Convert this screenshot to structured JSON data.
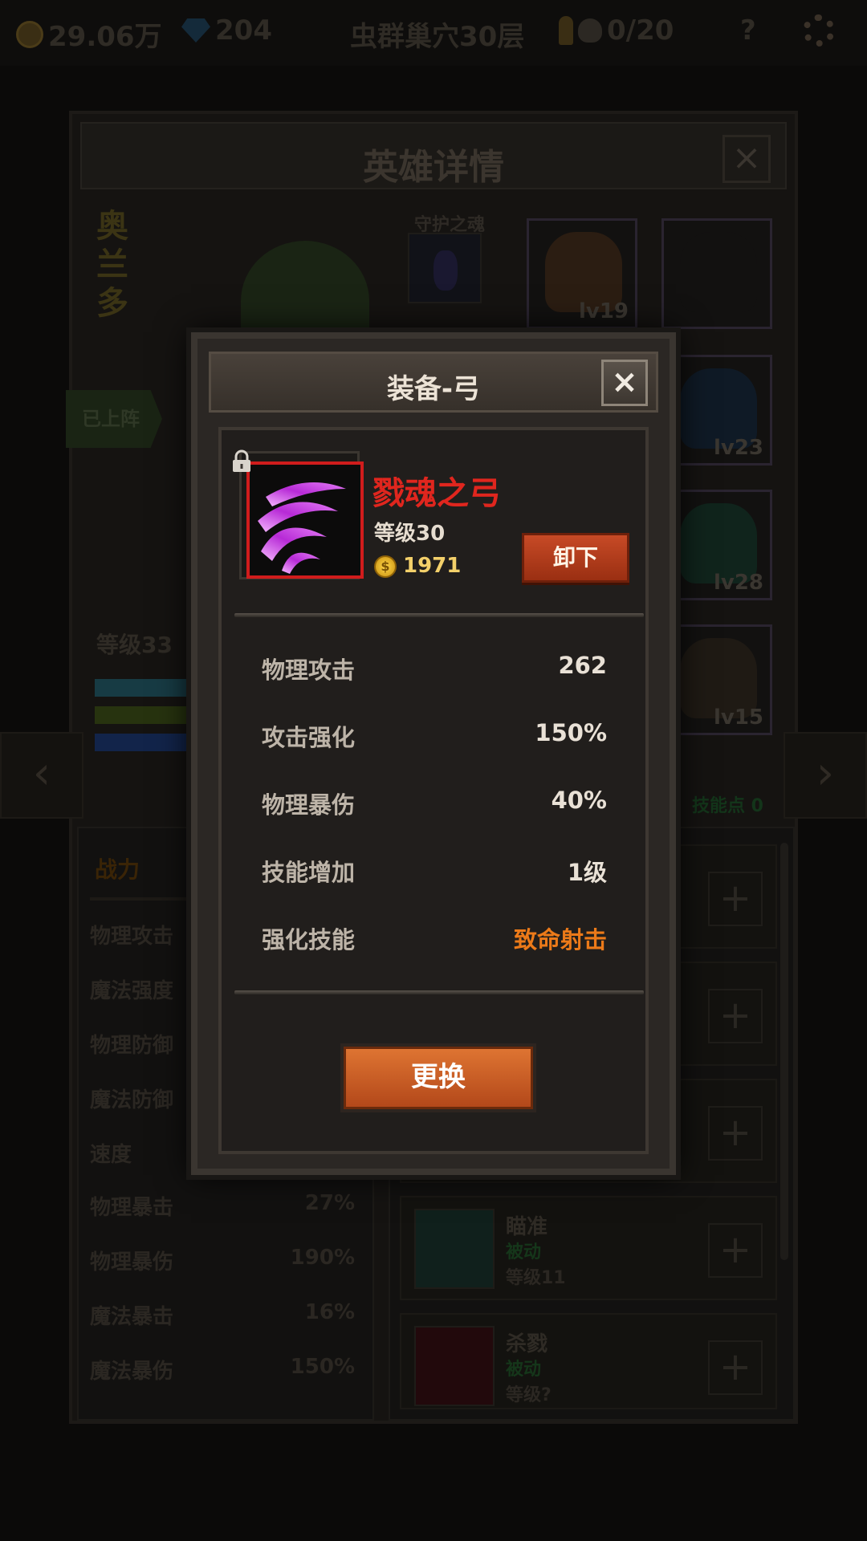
{
  "topbar": {
    "gold": "29.06万",
    "gems": "204",
    "location": "虫群巢穴30层",
    "keys": "0/20",
    "help": "?"
  },
  "hero": {
    "panel_title": "英雄详情",
    "close_icon": "×",
    "name": "奥兰多",
    "soul_label": "守护之魂",
    "deployed": "已上阵",
    "level": "等级33",
    "bar_colors": [
      "#173b44",
      "#27330f",
      "#12244a"
    ],
    "skill_points": "技能点 0",
    "prev_arrow": "‹",
    "next_arrow": "›",
    "equipment": [
      {
        "level": "lv19",
        "color": "#2b1d12"
      },
      {
        "level": "",
        "color": "#121110"
      },
      {
        "level": "lv23",
        "color": "#0f1a26"
      },
      {
        "level": "lv28",
        "color": "#10241c"
      },
      {
        "level": "lv15",
        "color": "#1f1a14"
      }
    ],
    "power_tab": "战力",
    "stats": [
      {
        "label": "物理攻击",
        "value": ""
      },
      {
        "label": "魔法强度",
        "value": ""
      },
      {
        "label": "物理防御",
        "value": ""
      },
      {
        "label": "魔法防御",
        "value": ""
      },
      {
        "label": "速度",
        "value": ""
      },
      {
        "label": "物理暴击",
        "value": "27%"
      },
      {
        "label": "物理暴伤",
        "value": "190%"
      },
      {
        "label": "魔法暴击",
        "value": "16%"
      },
      {
        "label": "魔法暴伤",
        "value": "150%"
      }
    ],
    "skills": [
      {
        "name": "",
        "type": "",
        "level": ""
      },
      {
        "name": "",
        "type": "",
        "level": ""
      },
      {
        "name": "",
        "type": "",
        "level": ""
      },
      {
        "name": "瞄准",
        "type": "被动",
        "level": "等级11"
      },
      {
        "name": "杀戮",
        "type": "被动",
        "level": "等级?"
      }
    ],
    "plus": "+"
  },
  "modal": {
    "title": "装备-弓",
    "close_icon": "×",
    "item_name": "戮魂之弓",
    "item_level": "等级30",
    "price": "1971",
    "coin_symbol": "$",
    "unequip_label": "卸下",
    "attributes": [
      {
        "label": "物理攻击",
        "value": "262"
      },
      {
        "label": "攻击强化",
        "value": "150%"
      },
      {
        "label": "物理暴伤",
        "value": "40%"
      },
      {
        "label": "技能增加",
        "value": "1级"
      },
      {
        "label": "强化技能",
        "value": "致命射击"
      }
    ],
    "replace_label": "更换",
    "colors": {
      "item_name": "#e0261e",
      "frame_border": "#d01c1c",
      "skill_highlight": "#ec7a19"
    }
  }
}
